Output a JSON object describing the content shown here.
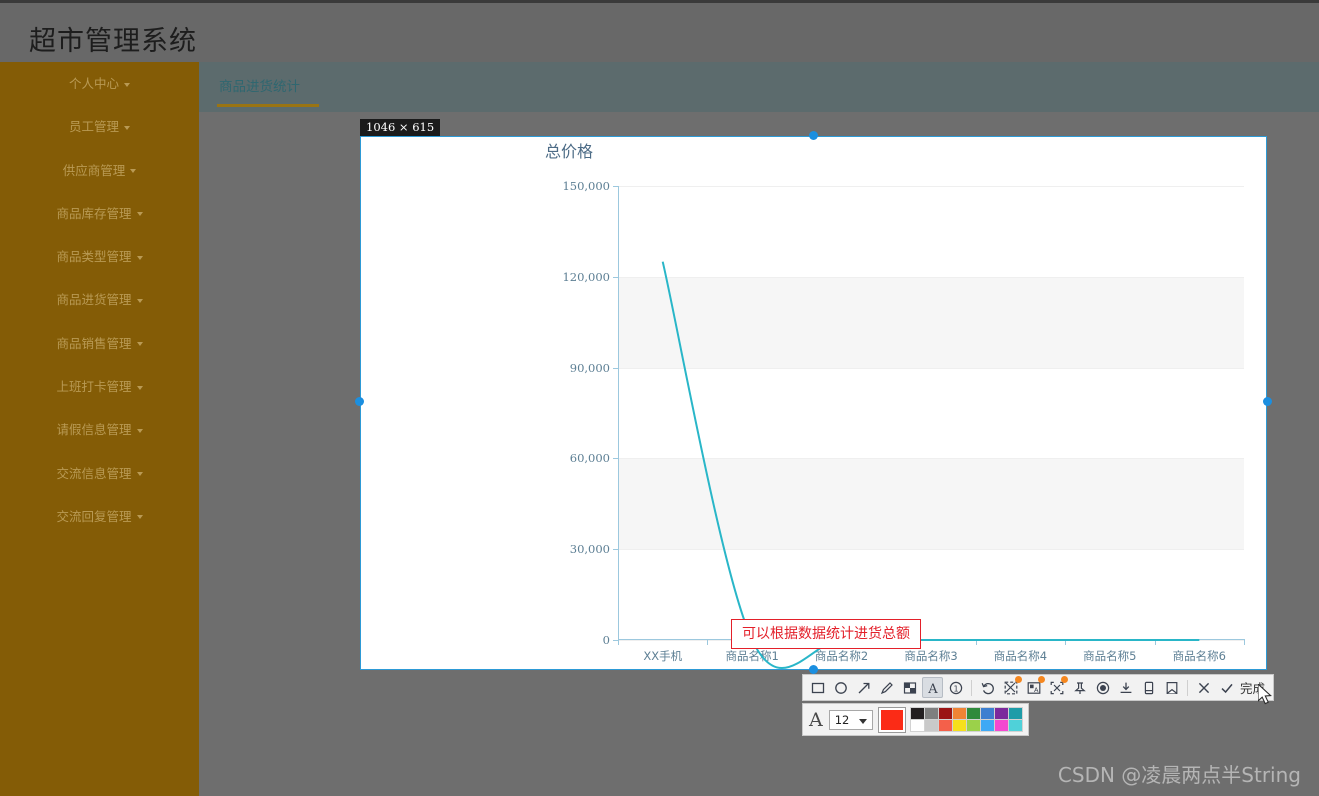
{
  "app": {
    "title": "超市管理系统"
  },
  "sidebar": {
    "items": [
      {
        "label": "个人中心"
      },
      {
        "label": "员工管理"
      },
      {
        "label": "供应商管理"
      },
      {
        "label": "商品库存管理"
      },
      {
        "label": "商品类型管理"
      },
      {
        "label": "商品进货管理"
      },
      {
        "label": "商品销售管理"
      },
      {
        "label": "上班打卡管理"
      },
      {
        "label": "请假信息管理"
      },
      {
        "label": "交流信息管理"
      },
      {
        "label": "交流回复管理"
      }
    ]
  },
  "tabs": [
    {
      "label": "商品进货统计",
      "active": true
    }
  ],
  "capture": {
    "size_badge": "1046 × 615",
    "annotation": "可以根据数据统计进货总额",
    "annotation_color": "#e3202a",
    "selection_color": "#2d9ad6"
  },
  "chart_data": {
    "type": "line",
    "title": "总价格",
    "categories": [
      "XX手机",
      "商品名称1",
      "商品名称2",
      "商品名称3",
      "商品名称4",
      "商品名称5",
      "商品名称6"
    ],
    "values": [
      125000,
      0,
      0,
      0,
      0,
      0,
      0
    ],
    "series": [
      {
        "name": "总价格",
        "values": [
          125000,
          0,
          0,
          0,
          0,
          0,
          0
        ],
        "color": "#29b6c8"
      }
    ],
    "yticks": [
      "150,000",
      "120,000",
      "90,000",
      "60,000",
      "30,000",
      "0"
    ],
    "ytick_values": [
      150000,
      120000,
      90000,
      60000,
      30000,
      0
    ],
    "ylim": [
      0,
      150000
    ],
    "xlabel": "",
    "ylabel": "",
    "grid": true,
    "legend": "none",
    "smooth": true
  },
  "toolbar": {
    "buttons": [
      {
        "name": "rectangle",
        "label": "矩形"
      },
      {
        "name": "ellipse",
        "label": "椭圆"
      },
      {
        "name": "arrow",
        "label": "箭头"
      },
      {
        "name": "pen",
        "label": "画笔"
      },
      {
        "name": "mosaic",
        "label": "马赛克"
      },
      {
        "name": "text",
        "label": "文字",
        "active": true
      },
      {
        "name": "step-number",
        "label": "序号"
      },
      {
        "name": "undo",
        "label": "撤销"
      },
      {
        "name": "smart-cut",
        "label": "智能裁剪",
        "badge": true
      },
      {
        "name": "ocr",
        "label": "文字识别",
        "badge": true
      },
      {
        "name": "extract",
        "label": "提取",
        "badge": true
      },
      {
        "name": "pin",
        "label": "贴图"
      },
      {
        "name": "record",
        "label": "录制"
      },
      {
        "name": "download",
        "label": "下载"
      },
      {
        "name": "save-device",
        "label": "保存到手机"
      },
      {
        "name": "collect",
        "label": "收藏"
      },
      {
        "name": "close",
        "label": "关闭"
      }
    ],
    "done_label": "完成"
  },
  "fontbar": {
    "font_icon": "A",
    "size_value": "12",
    "current_color": "#fb2b16",
    "palette_row1": [
      "#231f20",
      "#7f7f7f",
      "#9b1414",
      "#ef8436",
      "#2f8a3c",
      "#3d7fd0",
      "#7c2a9c",
      "#1e9ca8"
    ],
    "palette_row2": [
      "#ffffff",
      "#c9c9c9",
      "#f4604a",
      "#f6e01c",
      "#9bd14a",
      "#3fa9f5",
      "#f448d0",
      "#4fd1d9"
    ]
  },
  "watermark": {
    "text": "CSDN @凌晨两点半String"
  }
}
